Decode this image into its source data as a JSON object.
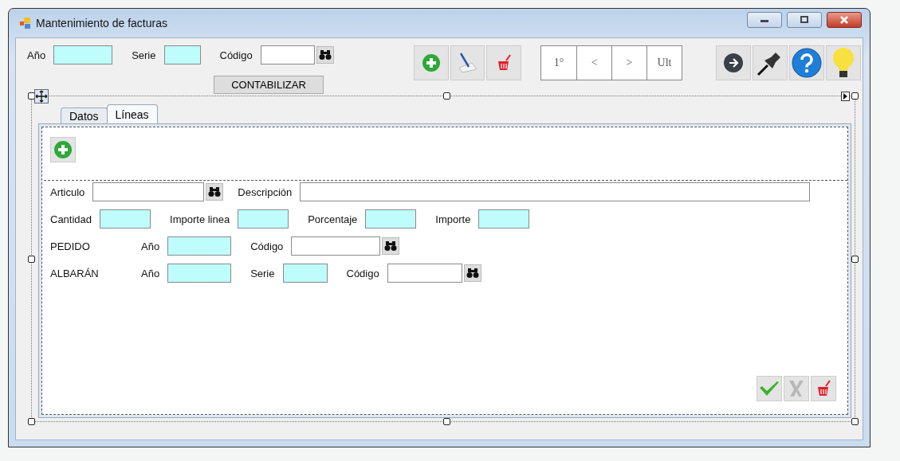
{
  "window": {
    "title": "Mantenimiento de facturas"
  },
  "header": {
    "items": [
      {
        "kind": "label",
        "text": "Año"
      },
      {
        "kind": "field",
        "color": "#bffcfc"
      },
      {
        "kind": "label",
        "text": "Serie"
      },
      {
        "kind": "field",
        "color": "#bffcfc"
      },
      {
        "kind": "label",
        "text": "Código"
      },
      {
        "kind": "field",
        "color": "#ffffff"
      },
      {
        "kind": "search"
      }
    ],
    "action": "CONTABILIZAR",
    "nav": [
      "1°",
      "<",
      ">",
      "Ult"
    ]
  },
  "tabs": [
    {
      "label": "Datos",
      "selected": false
    },
    {
      "label": "Líneas",
      "selected": true
    }
  ],
  "lines": {
    "rows": [
      [
        {
          "kind": "label",
          "text": "Articulo"
        },
        {
          "kind": "field",
          "color": "#ffffff"
        },
        {
          "kind": "search"
        },
        {
          "kind": "label",
          "text": "Descripción"
        },
        {
          "kind": "field",
          "color": "#ffffff"
        }
      ],
      [
        {
          "kind": "label",
          "text": "Cantidad"
        },
        {
          "kind": "field",
          "color": "#bffcfc"
        },
        {
          "kind": "label",
          "text": "Importe linea"
        },
        {
          "kind": "field",
          "color": "#bffcfc"
        },
        {
          "kind": "label",
          "text": "Porcentaje"
        },
        {
          "kind": "field",
          "color": "#bffcfc"
        },
        {
          "kind": "label",
          "text": "Importe"
        },
        {
          "kind": "field",
          "color": "#bffcfc"
        }
      ],
      [
        {
          "kind": "heading",
          "text": "PEDIDO"
        },
        {
          "kind": "label",
          "text": "Año"
        },
        {
          "kind": "field",
          "color": "#bffcfc"
        },
        {
          "kind": "label",
          "text": "Código"
        },
        {
          "kind": "field",
          "color": "#ffffff"
        },
        {
          "kind": "search"
        }
      ],
      [
        {
          "kind": "heading",
          "text": "ALBARÁN"
        },
        {
          "kind": "label",
          "text": "Año"
        },
        {
          "kind": "field",
          "color": "#bffcfc"
        },
        {
          "kind": "label",
          "text": "Serie"
        },
        {
          "kind": "field",
          "color": "#bffcfc"
        },
        {
          "kind": "label",
          "text": "Código"
        },
        {
          "kind": "field",
          "color": "#ffffff"
        },
        {
          "kind": "search"
        }
      ]
    ]
  }
}
